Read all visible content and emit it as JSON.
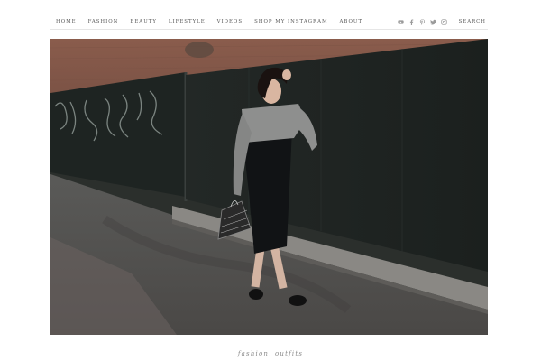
{
  "nav": {
    "items": [
      {
        "label": "HOME"
      },
      {
        "label": "FASHION"
      },
      {
        "label": "BEAUTY"
      },
      {
        "label": "LIFESTYLE"
      },
      {
        "label": "VIDEOS"
      },
      {
        "label": "SHOP MY INSTAGRAM"
      },
      {
        "label": "ABOUT"
      }
    ],
    "social_icons": [
      "youtube-icon",
      "facebook-icon",
      "pinterest-icon",
      "twitter-icon",
      "instagram-icon"
    ],
    "search_label": "SEARCH"
  },
  "post": {
    "categories": "fashion, outfits"
  },
  "colors": {
    "nav_text": "#555555",
    "icon": "#9a9a9a",
    "caption": "#8a8a8a"
  }
}
